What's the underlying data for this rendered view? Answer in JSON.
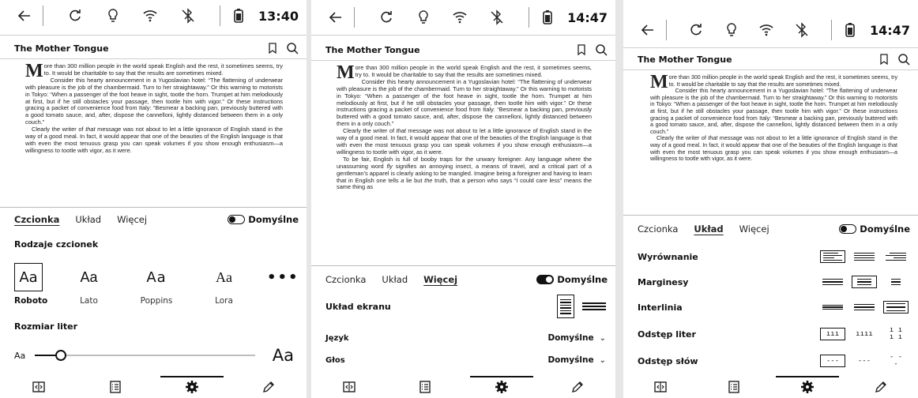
{
  "book": {
    "title": "The Mother Tongue",
    "drop_cap": "M",
    "p1": "ore than 300 million people in the world speak English and the rest, it sometimes seems, try to. It would be charitable to say that the results are sometimes mixed.",
    "p2": "Consider this hearty announcement in a Yugoslavian hotel: “The flattening of underwear with pleasure is the job of the chambermaid. Turn to her straightaway.” Or this warning to motorists in Tokyo: “When a passenger of the foot heave in sight, tootle the horn. Trumpet at him melodiously at first, but if he still obstacles your passage, then tootle him with vigor.” Or these instructions gracing a packet of convenience food from Italy: “Besmear a backing pan, previously buttered with a good tomato sauce, and, after, dispose the cannelloni, lightly distanced between them in a only couch.”",
    "p3_a": "Clearly the writer of ",
    "p3_em": "that",
    "p3_b": " message was not about to let a little ignorance of English stand in the way of a good meal. In fact, it would appear that one of the beauties of the English language is that with even the most tenuous grasp you can speak volumes if you show enough enthusiasm—a willingness to tootle with vigor, as it were.",
    "p4_a": "To be fair, English is full of booby traps for the unwary foreigner. Any language where the unassuming word ",
    "p4_em1": "fly",
    "p4_b": " signifies an annoying insect, a means of travel, and a critical part of a gentleman’s apparel is clearly asking to be mangled. Imagine being a foreigner and having to learn that in English one tells ",
    "p4_em2": "a",
    "p4_c": " lie but ",
    "p4_em3": "the",
    "p4_d": " truth, that a person who says “I could care less” means the same thing as"
  },
  "status": {
    "time_1": "13:40",
    "time_2": "14:47",
    "time_3": "14:47"
  },
  "tabs": {
    "fonts": "Czcionka",
    "layout": "Układ",
    "more": "Więcej",
    "defaults": "Domyślne"
  },
  "panel1": {
    "font_types_label": "Rodzaje czcionek",
    "fonts": [
      {
        "sample": "Aa",
        "name": "Roboto"
      },
      {
        "sample": "Aa",
        "name": "Lato"
      },
      {
        "sample": "Aa",
        "name": "Poppins"
      },
      {
        "sample": "Aa",
        "name": "Lora"
      }
    ],
    "more_glyph": "•••",
    "size_label": "Rozmiar liter",
    "size_small": "Aa",
    "size_big": "Aa",
    "size_value": 0.12,
    "defaults_on": false
  },
  "panel2": {
    "screen_layout_label": "Układ ekranu",
    "language_label": "Język",
    "language_value": "Domyślne",
    "voice_label": "Głos",
    "voice_value": "Domyślne",
    "defaults_on": true
  },
  "panel3": {
    "alignment_label": "Wyrównanie",
    "margins_label": "Marginesy",
    "line_spacing_label": "Interlinia",
    "letter_spacing_label": "Odstęp liter",
    "word_spacing_label": "Odstęp słów",
    "letter_samples": [
      "ııı",
      "ıııı",
      "ı ı ı ı"
    ],
    "word_samples": [
      "---",
      "---",
      "- - -"
    ],
    "defaults_on": false
  },
  "icons": {
    "back": "arrow-left-icon",
    "refresh": "refresh-icon",
    "light": "bulb-icon",
    "wifi": "wifi-icon",
    "bluetooth": "bluetooth-off-icon",
    "battery": "battery-icon",
    "bookmark": "bookmark-icon",
    "search": "search-icon",
    "nav": [
      "page-turn-icon",
      "table-of-contents-icon",
      "settings-gear-icon",
      "pen-icon"
    ]
  }
}
